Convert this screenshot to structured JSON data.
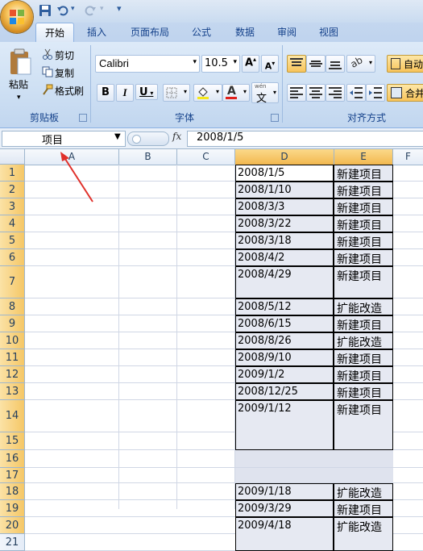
{
  "qat": {
    "icons": [
      "save-icon",
      "undo-icon",
      "redo-icon",
      "customize-icon"
    ]
  },
  "tabs": [
    {
      "label": "开始",
      "active": true
    },
    {
      "label": "插入"
    },
    {
      "label": "页面布局"
    },
    {
      "label": "公式"
    },
    {
      "label": "数据"
    },
    {
      "label": "审阅"
    },
    {
      "label": "视图"
    }
  ],
  "clipboard": {
    "paste": "粘贴",
    "cut": "剪切",
    "copy": "复制",
    "format_painter": "格式刷",
    "group": "剪贴板"
  },
  "font": {
    "name": "Calibri",
    "size": "10.5",
    "bold": "B",
    "italic": "I",
    "underline": "U",
    "group": "字体",
    "font_color": "#e0201b",
    "fill_color": "#f5e71a"
  },
  "alignment": {
    "group": "对齐方式",
    "wrap": "自动",
    "merge": "合并"
  },
  "formula_bar": {
    "name_box": "项目",
    "fx": "fx",
    "content": "2008/1/5"
  },
  "columns": [
    "A",
    "B",
    "C",
    "D",
    "E",
    "F"
  ],
  "rows": [
    "1",
    "2",
    "3",
    "4",
    "5",
    "6",
    "7",
    "8",
    "9",
    "10",
    "11",
    "12",
    "13",
    "14",
    "15",
    "16",
    "17",
    "18",
    "19",
    "20",
    "21"
  ],
  "records": [
    {
      "date": "2008/1/5",
      "type": "新建项目"
    },
    {
      "date": "2008/1/10",
      "type": "新建项目"
    },
    {
      "date": "2008/3/3",
      "type": "新建项目"
    },
    {
      "date": "2008/3/22",
      "type": "新建项目"
    },
    {
      "date": "2008/3/18",
      "type": "新建项目"
    },
    {
      "date": "2008/4/2",
      "type": "新建项目"
    },
    {
      "date": "2008/4/29",
      "type": "新建项目"
    },
    {
      "date": "2008/5/12",
      "type": "扩能改造"
    },
    {
      "date": "2008/6/15",
      "type": "新建项目"
    },
    {
      "date": "2008/8/26",
      "type": "扩能改造"
    },
    {
      "date": "2008/9/10",
      "type": "新建项目"
    },
    {
      "date": "2009/1/2",
      "type": "新建项目"
    },
    {
      "date": "2008/12/25",
      "type": "新建项目"
    },
    {
      "date": "2009/1/12",
      "type": "新建项目"
    },
    {
      "date": "2009/1/18",
      "type": "扩能改造"
    },
    {
      "date": "2009/3/29",
      "type": "新建项目"
    },
    {
      "date": "2009/4/18",
      "type": "扩能改造"
    }
  ]
}
